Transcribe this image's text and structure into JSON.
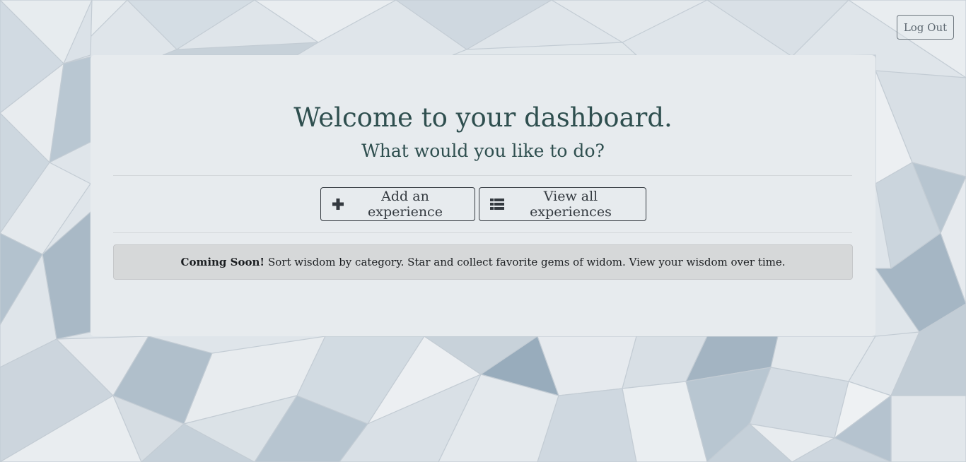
{
  "header": {
    "logout_label": "Log Out"
  },
  "dashboard": {
    "title": "Welcome to your dashboard.",
    "subtitle": "What would you like to do?",
    "add_button_label": "Add an experience",
    "view_button_label": "View all experiences",
    "add_icon": "plus-icon",
    "view_icon": "list-icon"
  },
  "notice": {
    "emphasis": "Coming Soon!",
    "text": "Sort wisdom by category. Star and collect favorite gems of widom. View your wisdom over time."
  },
  "colors": {
    "heading": "#2f4f4f",
    "panel": "#e7ebee",
    "button_border": "#343a40",
    "alert_bg": "#d6d8d9"
  }
}
